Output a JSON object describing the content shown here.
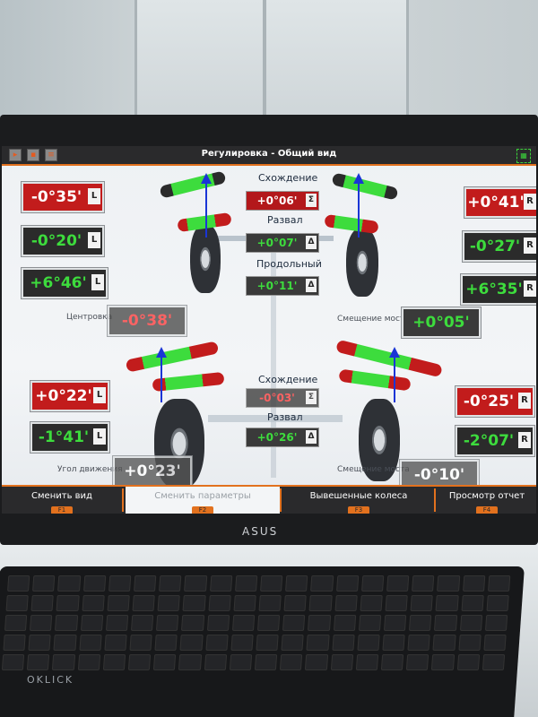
{
  "window": {
    "title": "Регулировка - Общий вид"
  },
  "front": {
    "left": [
      {
        "value": "-0°35'",
        "side": "L",
        "kind": "red"
      },
      {
        "value": "-0°20'",
        "side": "L",
        "kind": "green"
      },
      {
        "value": "+6°46'",
        "side": "L",
        "kind": "green"
      }
    ],
    "right": [
      {
        "value": "+0°41'",
        "side": "R",
        "kind": "red"
      },
      {
        "value": "-0°27'",
        "side": "R",
        "kind": "green"
      },
      {
        "value": "+6°35'",
        "side": "R",
        "kind": "green"
      }
    ],
    "center": [
      {
        "label": "Схождение",
        "value": "+0°06'",
        "side": "Σ"
      },
      {
        "label": "Развал",
        "value": "+0°07'",
        "side": "Δ"
      },
      {
        "label": "Продольный",
        "value": "+0°11'",
        "side": "Δ"
      }
    ],
    "centering": {
      "label": "Центровка",
      "value": "-0°38'"
    },
    "offset": {
      "label": "Смещение моста",
      "value": "+0°05'"
    }
  },
  "rear": {
    "left": [
      {
        "value": "+0°22'",
        "side": "L",
        "kind": "red"
      },
      {
        "value": "-1°41'",
        "side": "L",
        "kind": "green"
      }
    ],
    "right": [
      {
        "value": "-0°25'",
        "side": "R",
        "kind": "red"
      },
      {
        "value": "-2°07'",
        "side": "R",
        "kind": "green"
      }
    ],
    "center": [
      {
        "label": "Схождение",
        "value": "-0°03'",
        "side": "Σ"
      },
      {
        "label": "Развал",
        "value": "+0°26'",
        "side": "Δ"
      }
    ],
    "thrust": {
      "label": "Угол движения",
      "value": "+0°23'"
    },
    "offset": {
      "label": "Смещение моста",
      "value": "-0°10'"
    }
  },
  "function_keys": [
    {
      "label": "Сменить вид",
      "key": "F1"
    },
    {
      "label": "Сменить параметры",
      "key": "F2"
    },
    {
      "label": "Вывешенные колеса",
      "key": "F3"
    },
    {
      "label": "Просмотр отчет",
      "key": "F4"
    }
  ],
  "monitor_brand": "ASUS",
  "keyboard_brand": "OKLICK",
  "colors": {
    "accent": "#e2711e",
    "bad": "#c21c1c",
    "good": "#3ddc3d",
    "pointer": "#1a35d6"
  }
}
